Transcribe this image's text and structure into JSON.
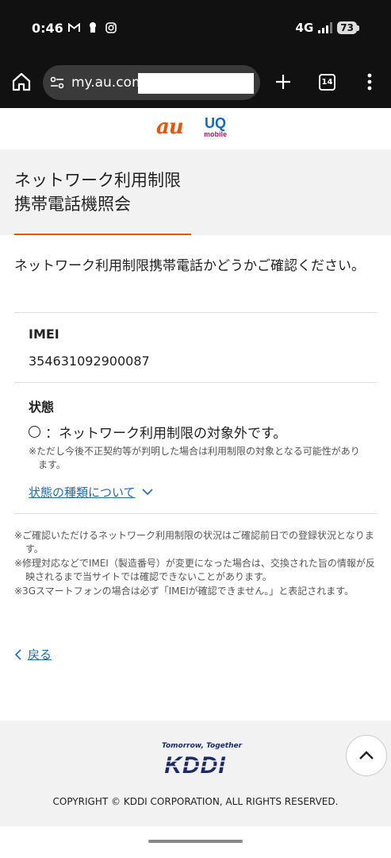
{
  "status_bar": {
    "time": "0:46",
    "network": "4G",
    "battery": "73"
  },
  "browser": {
    "url": "my.au.com",
    "tab_count": "14"
  },
  "brand": {
    "au_logo": "au",
    "uq_logo": "UQ",
    "uq_sub": "mobile"
  },
  "page": {
    "title_line1": "ネットワーク利用制限",
    "title_line2": "携帯電話機照会",
    "lead": "ネットワーク利用制限携帯電話かどうかご確認ください。"
  },
  "imei": {
    "label": "IMEI",
    "value": "354631092900087"
  },
  "status": {
    "label": "状態",
    "text": "：ネットワーク利用制限の対象外です。",
    "note": "※ただし今後不正契約等が判明した場合は利用制限の対象となる可能性があります。",
    "link": "状態の種類について"
  },
  "notes": [
    "※ご確認いただけるネットワーク利用制限の状況はご確認前日での登録状況となります。",
    "※修理対応などでIMEI（製造番号）が変更になった場合は、交換された旨の情報が反映されるまで当サイトでは確認できないことがあります。",
    "※3Gスマートフォンの場合は必ず「IMEIが確認できません。」と表記されます。"
  ],
  "back": {
    "label": "戻る"
  },
  "footer": {
    "tagline": "Tomorrow, Together",
    "logo": "KDDI",
    "copyright": "COPYRIGHT © KDDI CORPORATION, ALL RIGHTS RESERVED."
  },
  "colors": {
    "accent": "#eb5505",
    "link": "#1a6bbf",
    "kddi": "#1b2a6b"
  }
}
